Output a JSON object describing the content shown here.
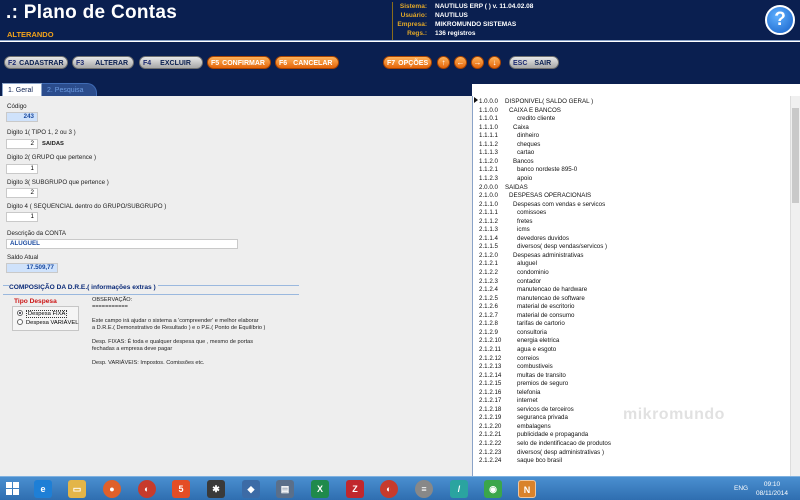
{
  "header": {
    "title": ".: Plano de Contas",
    "mode": "ALTERANDO",
    "info": [
      {
        "label": "Sistema:",
        "value": "NAUTILUS ERP (  )  v. 11.04.02.08"
      },
      {
        "label": "Usuário:",
        "value": "NAUTILUS"
      },
      {
        "label": "Empresa:",
        "value": "MIKROMUNDO SISTEMAS"
      },
      {
        "label": "Regs.:",
        "value": "136 registros"
      }
    ],
    "help_label": "?"
  },
  "toolbar": {
    "cadastrar": {
      "key": "F2",
      "label": "CADASTRAR"
    },
    "alterar": {
      "key": "F3",
      "label": "ALTERAR"
    },
    "excluir": {
      "key": "F4",
      "label": "EXCLUIR"
    },
    "confirmar": {
      "key": "F5",
      "label": "CONFIRMAR"
    },
    "cancelar": {
      "key": "F6",
      "label": "CANCELAR"
    },
    "opcoes": {
      "key": "F7",
      "label": "OPÇÕES"
    },
    "sair": {
      "key": "ESC",
      "label": "SAIR"
    },
    "arrows": {
      "up": "↑",
      "left": "←",
      "right": "→",
      "down": "↓"
    }
  },
  "tabs": {
    "geral": "1. Geral",
    "pesquisa": "2. Pesquisa"
  },
  "form": {
    "codigo": {
      "label": "Código",
      "value": "243"
    },
    "digito1": {
      "label": "Digito 1( TIPO 1, 2 ou 3 )",
      "value": "2",
      "hint": "SAIDAS"
    },
    "digito2": {
      "label": "Digito 2( GRUPO que pertence )",
      "value": "1"
    },
    "digito3": {
      "label": "Digito 3( SUBGRUPO que pertence )",
      "value": "2"
    },
    "digito4": {
      "label": "Digito 4 ( SEQUENCIAL dentro do GRUPO/SUBGRUPO )",
      "value": "1"
    },
    "descricao": {
      "label": "Descrição da CONTA",
      "value": "ALUGUEL"
    },
    "saldo": {
      "label": "Saldo Atual",
      "value": "17.509,77"
    }
  },
  "dre": {
    "title": "COMPOSIÇÃO DA D.R.E.( informações extras )",
    "tipo_label": "Tipo Despesa",
    "options": [
      "Despesa FIXA",
      "Despesa VARIÁVEL"
    ],
    "selected": "Despesa FIXA",
    "obs_lines": [
      "OBSERVAÇÃO:",
      "===========",
      "",
      "Este campo irá ajudar o sistema a 'compreender' e melhor elaborar",
      "a D.R.E.( Demonstrativo de Resultado ) e o P.E.( Ponto de Equilíbrio )",
      "",
      "Desp. FIXAS: É toda e qualquer despesa que , mesmo de portas",
      "fechadas a empresa deve pagar",
      "",
      "Desp. VARIÁVEIS: Impostos. Comissões etc."
    ]
  },
  "tree": {
    "rows": [
      {
        "code": "1.0.0.0",
        "name": "DISPONIVEL( SALDO GERAL )",
        "level": 0
      },
      {
        "code": "1.1.0.0",
        "name": "CAIXA E BANCOS",
        "level": 1
      },
      {
        "code": "1.1.0.1",
        "name": "credito cliente",
        "level": 3
      },
      {
        "code": "1.1.1.0",
        "name": "Caixa",
        "level": 2
      },
      {
        "code": "1.1.1.1",
        "name": "dinheiro",
        "level": 3
      },
      {
        "code": "1.1.1.2",
        "name": "cheques",
        "level": 3
      },
      {
        "code": "1.1.1.3",
        "name": "cartao",
        "level": 3
      },
      {
        "code": "1.1.2.0",
        "name": "Bancos",
        "level": 2
      },
      {
        "code": "1.1.2.1",
        "name": "banco nordeste 895-0",
        "level": 3
      },
      {
        "code": "1.1.2.3",
        "name": "apoio",
        "level": 3
      },
      {
        "code": "2.0.0.0",
        "name": "SAIDAS",
        "level": 0
      },
      {
        "code": "2.1.0.0",
        "name": "DESPESAS OPERACIONAIS",
        "level": 1
      },
      {
        "code": "2.1.1.0",
        "name": "Despesas com vendas e servicos",
        "level": 2
      },
      {
        "code": "2.1.1.1",
        "name": "comissoes",
        "level": 3
      },
      {
        "code": "2.1.1.2",
        "name": "fretes",
        "level": 3
      },
      {
        "code": "2.1.1.3",
        "name": "icms",
        "level": 3
      },
      {
        "code": "2.1.1.4",
        "name": "devedores duvidos",
        "level": 3
      },
      {
        "code": "2.1.1.5",
        "name": "diversos( desp vendas/servicos )",
        "level": 3
      },
      {
        "code": "2.1.2.0",
        "name": "Despesas administrativas",
        "level": 2
      },
      {
        "code": "2.1.2.1",
        "name": "aluguel",
        "level": 3
      },
      {
        "code": "2.1.2.2",
        "name": "condominio",
        "level": 3
      },
      {
        "code": "2.1.2.3",
        "name": "contador",
        "level": 3
      },
      {
        "code": "2.1.2.4",
        "name": "manutencao de hardware",
        "level": 3
      },
      {
        "code": "2.1.2.5",
        "name": "manutencao de software",
        "level": 3
      },
      {
        "code": "2.1.2.6",
        "name": "material de escritorio",
        "level": 3
      },
      {
        "code": "2.1.2.7",
        "name": "material de consumo",
        "level": 3
      },
      {
        "code": "2.1.2.8",
        "name": "tarifas de cartorio",
        "level": 3
      },
      {
        "code": "2.1.2.9",
        "name": "consultoria",
        "level": 3
      },
      {
        "code": "2.1.2.10",
        "name": "energia eletrica",
        "level": 3
      },
      {
        "code": "2.1.2.11",
        "name": "agua e esgoto",
        "level": 3
      },
      {
        "code": "2.1.2.12",
        "name": "correios",
        "level": 3
      },
      {
        "code": "2.1.2.13",
        "name": "combustiveis",
        "level": 3
      },
      {
        "code": "2.1.2.14",
        "name": "multas de transito",
        "level": 3
      },
      {
        "code": "2.1.2.15",
        "name": "premios de seguro",
        "level": 3
      },
      {
        "code": "2.1.2.16",
        "name": "telefonia",
        "level": 3
      },
      {
        "code": "2.1.2.17",
        "name": "internet",
        "level": 3
      },
      {
        "code": "2.1.2.18",
        "name": "servicos de terceiros",
        "level": 3
      },
      {
        "code": "2.1.2.19",
        "name": "seguranca privada",
        "level": 3
      },
      {
        "code": "2.1.2.20",
        "name": "embalagens",
        "level": 3
      },
      {
        "code": "2.1.2.21",
        "name": "publicidade e propaganda",
        "level": 3
      },
      {
        "code": "2.1.2.22",
        "name": "selo de indentificacao de produtos",
        "level": 3
      },
      {
        "code": "2.1.2.23",
        "name": "diversos( desp administrativas )",
        "level": 3
      },
      {
        "code": "2.1.2.24",
        "name": "saque bco brasil",
        "level": 3
      }
    ],
    "watermark": "mikromundo"
  },
  "taskbar": {
    "lang": "ENG",
    "time": "09:10",
    "date": "08/11/2014"
  }
}
